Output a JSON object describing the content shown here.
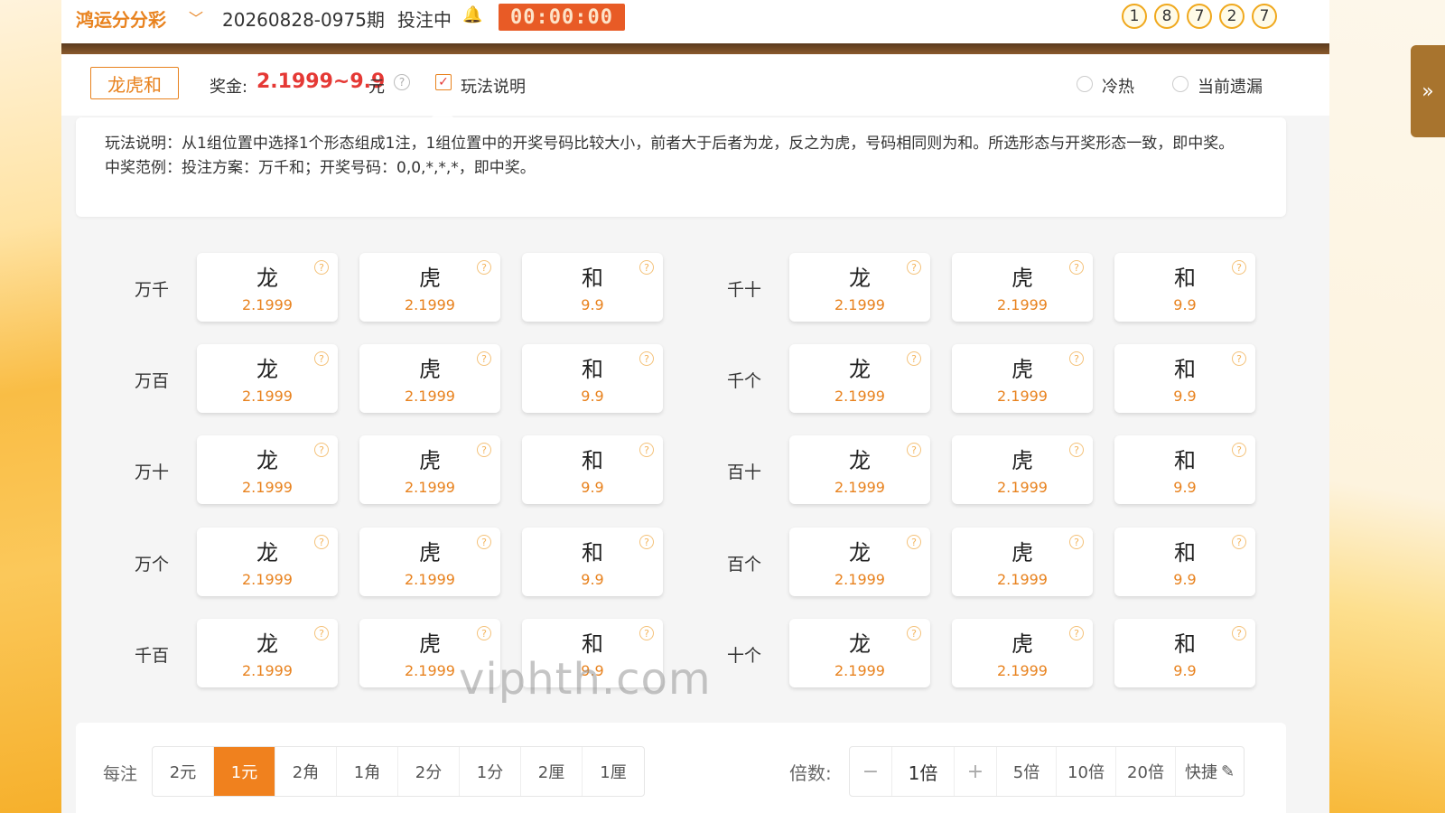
{
  "header": {
    "lottery_name": "鸿运分分彩",
    "issue": "20260828-0975期",
    "status": "投注中",
    "timer": "00:00:00",
    "result_balls": [
      "1",
      "8",
      "7",
      "2",
      "7"
    ]
  },
  "subbar": {
    "play_type": "龙虎和",
    "prize_label": "奖金:",
    "prize_value": "2.1999~9.9",
    "prize_unit": "元",
    "rules_label": "玩法说明",
    "rules_checked": true,
    "radio_hot_cold": "冷热",
    "radio_missing": "当前遗漏"
  },
  "description": {
    "line1": "玩法说明：从1组位置中选择1个形态组成1注，1组位置中的开奖号码比较大小，前者大于后者为龙，反之为虎，号码相同则为和。所选形态与开奖形态一致，即中奖。",
    "line2": "中奖范例：投注方案：万千和；开奖号码：0,0,*,*,*，即中奖。"
  },
  "options": [
    {
      "label": "龙",
      "odds": "2.1999",
      "help": "?"
    },
    {
      "label": "虎",
      "odds": "2.1999",
      "help": "?"
    },
    {
      "label": "和",
      "odds": "9.9",
      "help": "?"
    }
  ],
  "groups_left": [
    "万千",
    "万百",
    "万十",
    "万个",
    "千百"
  ],
  "groups_right": [
    "千十",
    "千个",
    "百十",
    "百个",
    "十个"
  ],
  "watermark": "viphth.com",
  "footer": {
    "per_bet_label": "每注",
    "units": [
      "2元",
      "1元",
      "2角",
      "1角",
      "2分",
      "1分",
      "2厘",
      "1厘"
    ],
    "active_unit": "1元",
    "multiplier_label": "倍数:",
    "minus": "−",
    "multiplier_value": "1倍",
    "plus": "+",
    "presets": [
      "5倍",
      "10倍",
      "20倍"
    ],
    "quick_label": "快捷"
  }
}
